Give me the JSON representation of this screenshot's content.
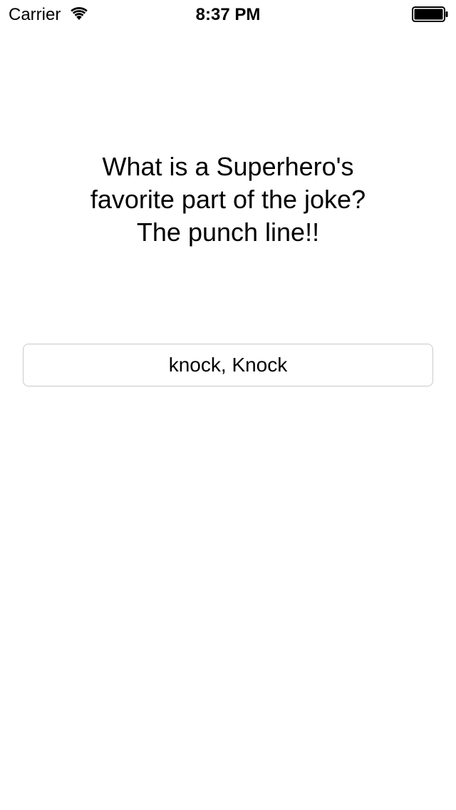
{
  "status_bar": {
    "carrier": "Carrier",
    "time": "8:37 PM",
    "wifi_icon": "wifi-icon",
    "battery_icon": "battery-icon",
    "battery_level": 1.0
  },
  "main": {
    "joke_text": "What is a Superhero's\nfavorite part of the joke?\nThe punch line!!",
    "button_label": "knock, Knock"
  },
  "colors": {
    "background": "#ffffff",
    "text": "#000000",
    "button_border": "#c9c9c9"
  }
}
